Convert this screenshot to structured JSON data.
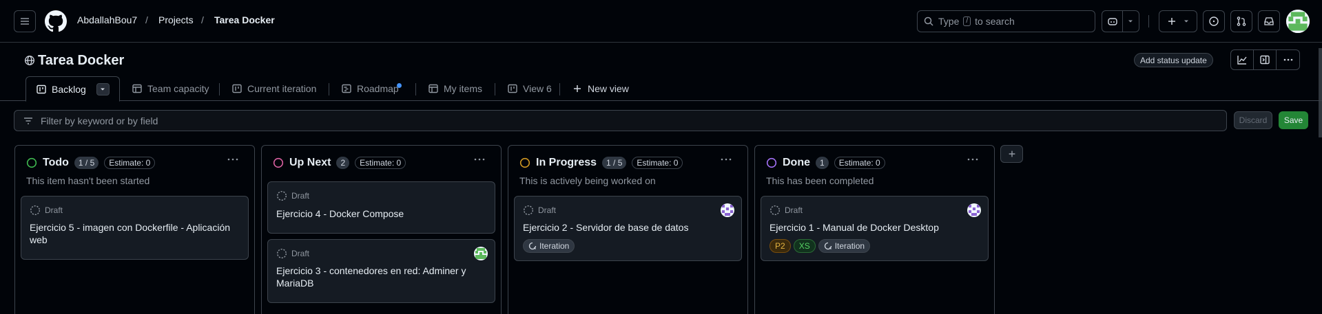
{
  "header": {
    "breadcrumb": [
      "AbdallahBou7",
      "Projects",
      "Tarea Docker"
    ],
    "separator": "/",
    "search_prefix": "Type",
    "search_key": "/",
    "search_suffix": "to search"
  },
  "project": {
    "title": "Tarea Docker",
    "status_button": "Add status update"
  },
  "tabs": [
    {
      "label": "Backlog",
      "icon": "board-icon",
      "active": true
    },
    {
      "label": "Team capacity",
      "icon": "table-icon"
    },
    {
      "label": "Current iteration",
      "icon": "board-icon"
    },
    {
      "label": "Roadmap",
      "icon": "roadmap-icon",
      "indicator": true
    },
    {
      "label": "My items",
      "icon": "table-icon"
    },
    {
      "label": "View 6",
      "icon": "board-icon"
    },
    {
      "label": "New view",
      "icon": "plus-icon"
    }
  ],
  "filter": {
    "placeholder": "Filter by keyword or by field",
    "discard_label": "Discard",
    "save_label": "Save"
  },
  "columns": [
    {
      "name": "Todo",
      "count": "1 / 5",
      "estimate": "Estimate: 0",
      "description": "This item hasn't been started",
      "color": "#3fb950",
      "cards": [
        {
          "status": "Draft",
          "title_lines": [
            "Ejercicio 5 - imagen con Dockerfile - Aplicación",
            "web"
          ]
        }
      ]
    },
    {
      "name": "Up Next",
      "count": "2",
      "estimate": "Estimate: 0",
      "description": "",
      "color": "#db61a2",
      "cards": [
        {
          "status": "Draft",
          "title_lines": [
            "Ejercicio 4 - Docker Compose"
          ]
        },
        {
          "status": "Draft",
          "title_lines": [
            "Ejercicio 3 - contenedores en red: Adminer y",
            "MariaDB"
          ],
          "avatar": "green"
        }
      ]
    },
    {
      "name": "In Progress",
      "count": "1 / 5",
      "estimate": "Estimate: 0",
      "description": "This is actively being worked on",
      "color": "#d29922",
      "cards": [
        {
          "status": "Draft",
          "title_lines": [
            "Ejercicio 2 - Servidor de base de datos"
          ],
          "avatar": "purple",
          "tags": [
            "Iteration"
          ]
        }
      ]
    },
    {
      "name": "Done",
      "count": "1",
      "estimate": "Estimate: 0",
      "description": "This has been completed",
      "color": "#a371f7",
      "cards": [
        {
          "status": "Draft",
          "title_lines": [
            "Ejercicio 1 - Manual de Docker Desktop"
          ],
          "avatar": "purple",
          "tags": [
            "P2",
            "XS",
            "Iteration"
          ]
        }
      ]
    }
  ]
}
